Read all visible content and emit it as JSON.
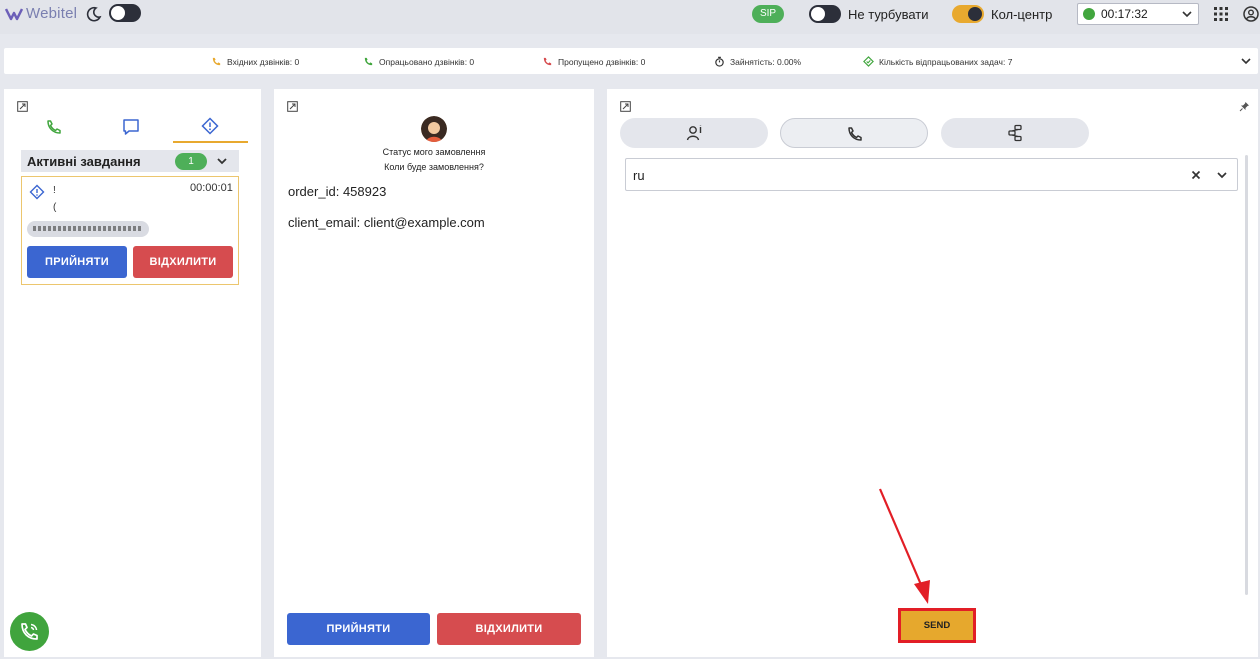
{
  "topbar": {
    "logo_text": "Webitel",
    "sip_label": "SIP",
    "dnd_label": "Не турбувати",
    "callcenter_label": "Кол-центр",
    "timer": "00:17:32",
    "status_color": "#41a63e",
    "accent_color": "#e8a92f"
  },
  "stats": {
    "incoming": "Вхідних дзвінків: 0",
    "handled": "Опрацьовано дзвінків: 0",
    "missed": "Пропущено дзвінків: 0",
    "occupancy": "Зайнятість: 0.00%",
    "tasks_done": "Кількість відпрацьованих задач: 7"
  },
  "left_panel": {
    "tabs": [
      "phone-icon",
      "chat-icon",
      "task-icon"
    ],
    "active_tab": 2,
    "tasks_header": "Активні завдання",
    "tasks_count": "1",
    "task": {
      "line1": "!",
      "line2": "(",
      "time": "00:00:01"
    },
    "accept_label": "ПРИЙНЯТИ",
    "reject_label": "ВІДХИЛИТИ"
  },
  "middle_panel": {
    "title": "Статус мого замовлення",
    "subtitle": "Коли буде замовлення?",
    "fields": [
      {
        "key": "order_id:",
        "value": "458923"
      },
      {
        "key": "client_email:",
        "value": "client@example.com"
      }
    ],
    "accept_label": "ПРИЙНЯТИ",
    "reject_label": "ВІДХИЛИТИ"
  },
  "right_panel": {
    "tabs": [
      "agent-info-icon",
      "phone-icon",
      "flow-icon"
    ],
    "selected_tab": 1,
    "language_value": "ru",
    "send_label": "SEND",
    "highlight_color": "#e21e26"
  }
}
